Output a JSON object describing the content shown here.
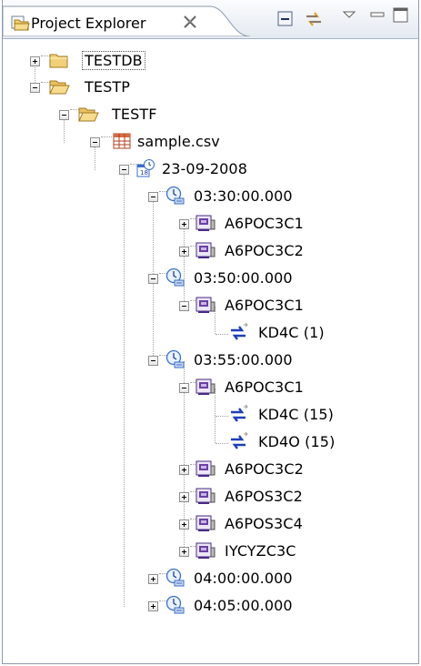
{
  "view": {
    "title": "Project Explorer",
    "close_glyph": "✕",
    "toolbar": [
      "collapse-all-icon",
      "link-with-editor-icon",
      "view-menu-icon",
      "minimize-icon",
      "maximize-icon"
    ]
  },
  "tree": {
    "testdb": "TESTDB",
    "testp": "TESTP",
    "testf": "TESTF",
    "csv": "sample.csv",
    "date": "23-09-2008",
    "t1": "03:30:00.000",
    "t1_a": "A6POC3C1",
    "t1_b": "A6POC3C2",
    "t2": "03:50:00.000",
    "t2_a": "A6POC3C1",
    "t2_a_1": "KD4C (1)",
    "t3": "03:55:00.000",
    "t3_a": "A6POC3C1",
    "t3_a_1": "KD4C (15)",
    "t3_a_2": "KD4O (15)",
    "t3_b": "A6POC3C2",
    "t3_c": "A6POS3C2",
    "t3_d": "A6POS3C4",
    "t3_e": "IYCYZC3C",
    "t4": "04:00:00.000",
    "t5": "04:05:00.000"
  },
  "colors": {
    "folder": "#e8c46a",
    "clock": "#3b6fc9",
    "device": "#6a3fa8",
    "link": "#1f3fb8"
  }
}
